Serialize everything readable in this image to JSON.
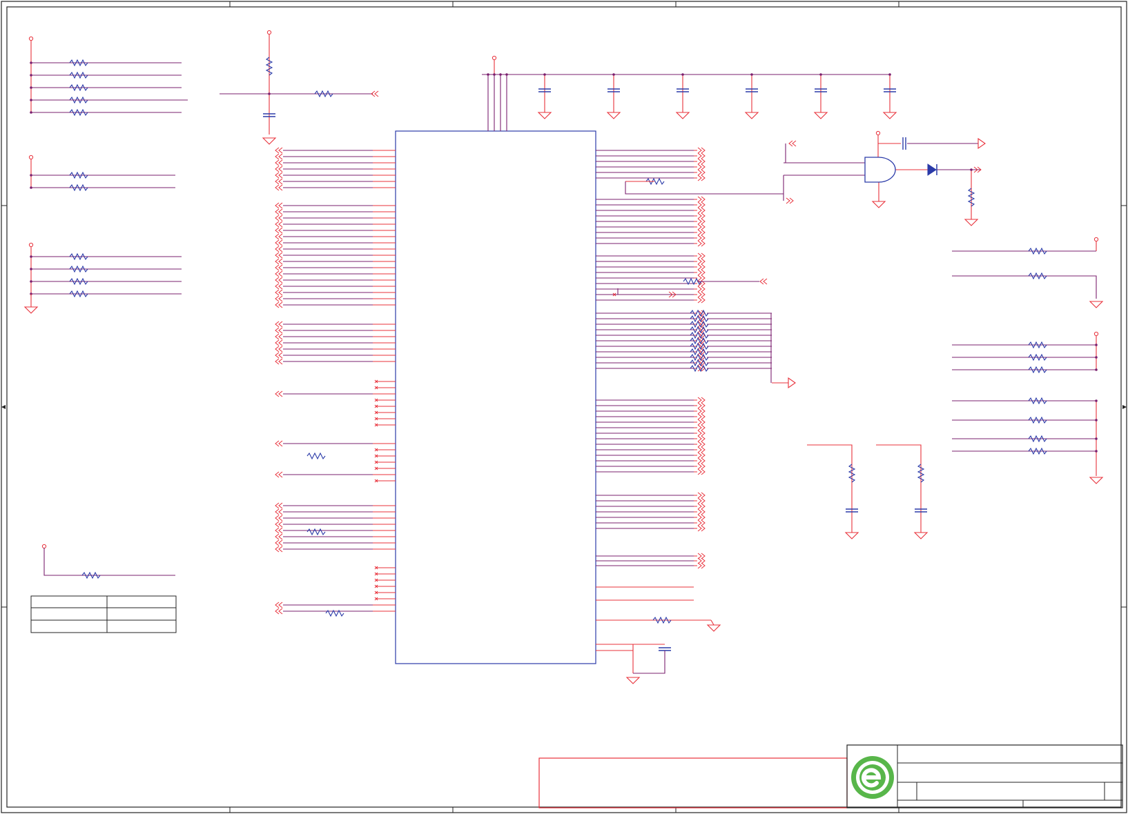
{
  "sheet": {
    "wire_color": "#e8303a",
    "symbol_color": "#2a3aa8",
    "net_color": "#7a1f6e",
    "ground_color": "#e8303a",
    "logo_color": "#58b64a",
    "frame_color": "#222222"
  },
  "logo": {
    "icon": "e-circle-logo-icon"
  },
  "title_block": {
    "title": "",
    "doc_no": "",
    "rev": "",
    "sheet": ""
  },
  "legend_table": {
    "rows": [
      [
        "",
        ""
      ],
      [
        "",
        ""
      ],
      [
        "",
        ""
      ]
    ]
  }
}
